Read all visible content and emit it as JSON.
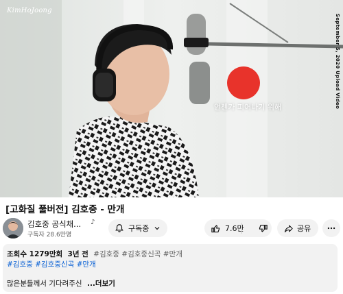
{
  "video": {
    "logo_text": "KimHoJoong",
    "upload_note": "September 5, 2020 Upload Video",
    "lyric": "언젠가 피어나기 위해",
    "title": "[고화질 풀버전] 김호중 - 만개"
  },
  "channel": {
    "name": "김호중 공식채...",
    "subscribers": "구독자 28.6만명",
    "note_icon": "music-note-icon",
    "subscribe_label": "구독중"
  },
  "actions": {
    "like_count": "7.6만",
    "share_label": "공유"
  },
  "description": {
    "views": "조회수 1279만회",
    "age": "3년 전",
    "tags_line1": [
      "#김호중",
      "#김호중신곡",
      "#만개"
    ],
    "tags_line2": [
      "#김호중",
      "#김호중신곡",
      "#만개"
    ],
    "text": "많은분들께서 기다려주신",
    "more_label": "...더보기"
  },
  "colors": {
    "accent_red": "#e8332b",
    "link_blue": "#065fd4",
    "pill_gray": "#f2f2f2"
  }
}
